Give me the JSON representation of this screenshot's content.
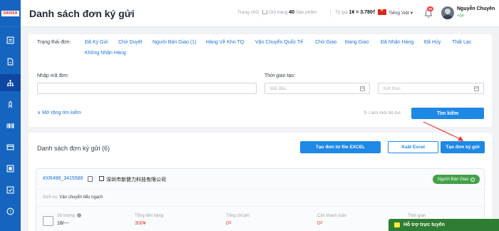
{
  "header": {
    "title": "Danh sách đơn ký gửi",
    "home": "Trang chủ",
    "cart_label": "Giỏ hàng",
    "cart_count": "40",
    "cart_unit": "Sản phẩm",
    "rate_label": "Tỷ giá",
    "rate_value": "1¥ = 3.780₫",
    "language": "Tiếng Việt",
    "notification_count": "10",
    "user_name": "Nguyễn Chuyên",
    "user_balance": "+0₫"
  },
  "filter": {
    "status_label": "Trạng thái đơn:",
    "statuses": [
      "Đã Ký Gửi",
      "Chờ Duyệt",
      "Người Bán Giao (1)",
      "Hàng Về Kho TQ",
      "Vận Chuyển Quốc Tế",
      "Chờ Giao",
      "Đang Giao",
      "Đã Nhận Hàng",
      "Đã Hủy",
      "Thất Lạc",
      "Không Nhận Hàng"
    ],
    "order_code_label": "Nhập mã đơn:",
    "order_code_value": "",
    "created_time_label": "Thời gian tạo:",
    "start_placeholder": "Bắt đầu",
    "end_placeholder": "Kết thúc",
    "expand_search": "Mở rộng tìm kiếm",
    "reset_filter": "Làm mới bộ lọc",
    "search_button": "Tìm kiếm"
  },
  "list": {
    "title": "Danh sách đơn ký gửi (6)",
    "import_excel": "Tạo đơn từ file EXCEL",
    "export_excel": "Xuất Excel",
    "create_order": "Tạo đơn ký gửi",
    "orders": [
      {
        "code": "#XR498_3415588",
        "shop": "深圳市新健力科技有限公司",
        "status": "Người Bán Giao",
        "service_label": "Dịch vụ:",
        "service_value": "Vận chuyển tiểu ngạch",
        "quantity_label": "Số lượng",
        "quantity_value": "18/---",
        "total_goods_label": "Tổng tiền hàng",
        "total_goods_value": "300¥",
        "total_cost_label": "Tổng chi phí",
        "total_cost_value": "0₫",
        "payment_due_label": "Cần thanh toán",
        "payment_due_value": "0₫",
        "time_label": "Thời gian"
      }
    ]
  },
  "chat": {
    "label": "Hỗ trợ trực tuyến"
  },
  "colors": {
    "primary": "#1e88e5",
    "sidebar": "#1565c0",
    "success": "#43a047",
    "danger": "#e53935"
  },
  "sidebar_icons": [
    "list-icon",
    "document-icon",
    "network-icon",
    "rocket-icon",
    "barcode-icon",
    "wallet-icon",
    "ticket-icon",
    "checklist-icon",
    "help-icon"
  ]
}
